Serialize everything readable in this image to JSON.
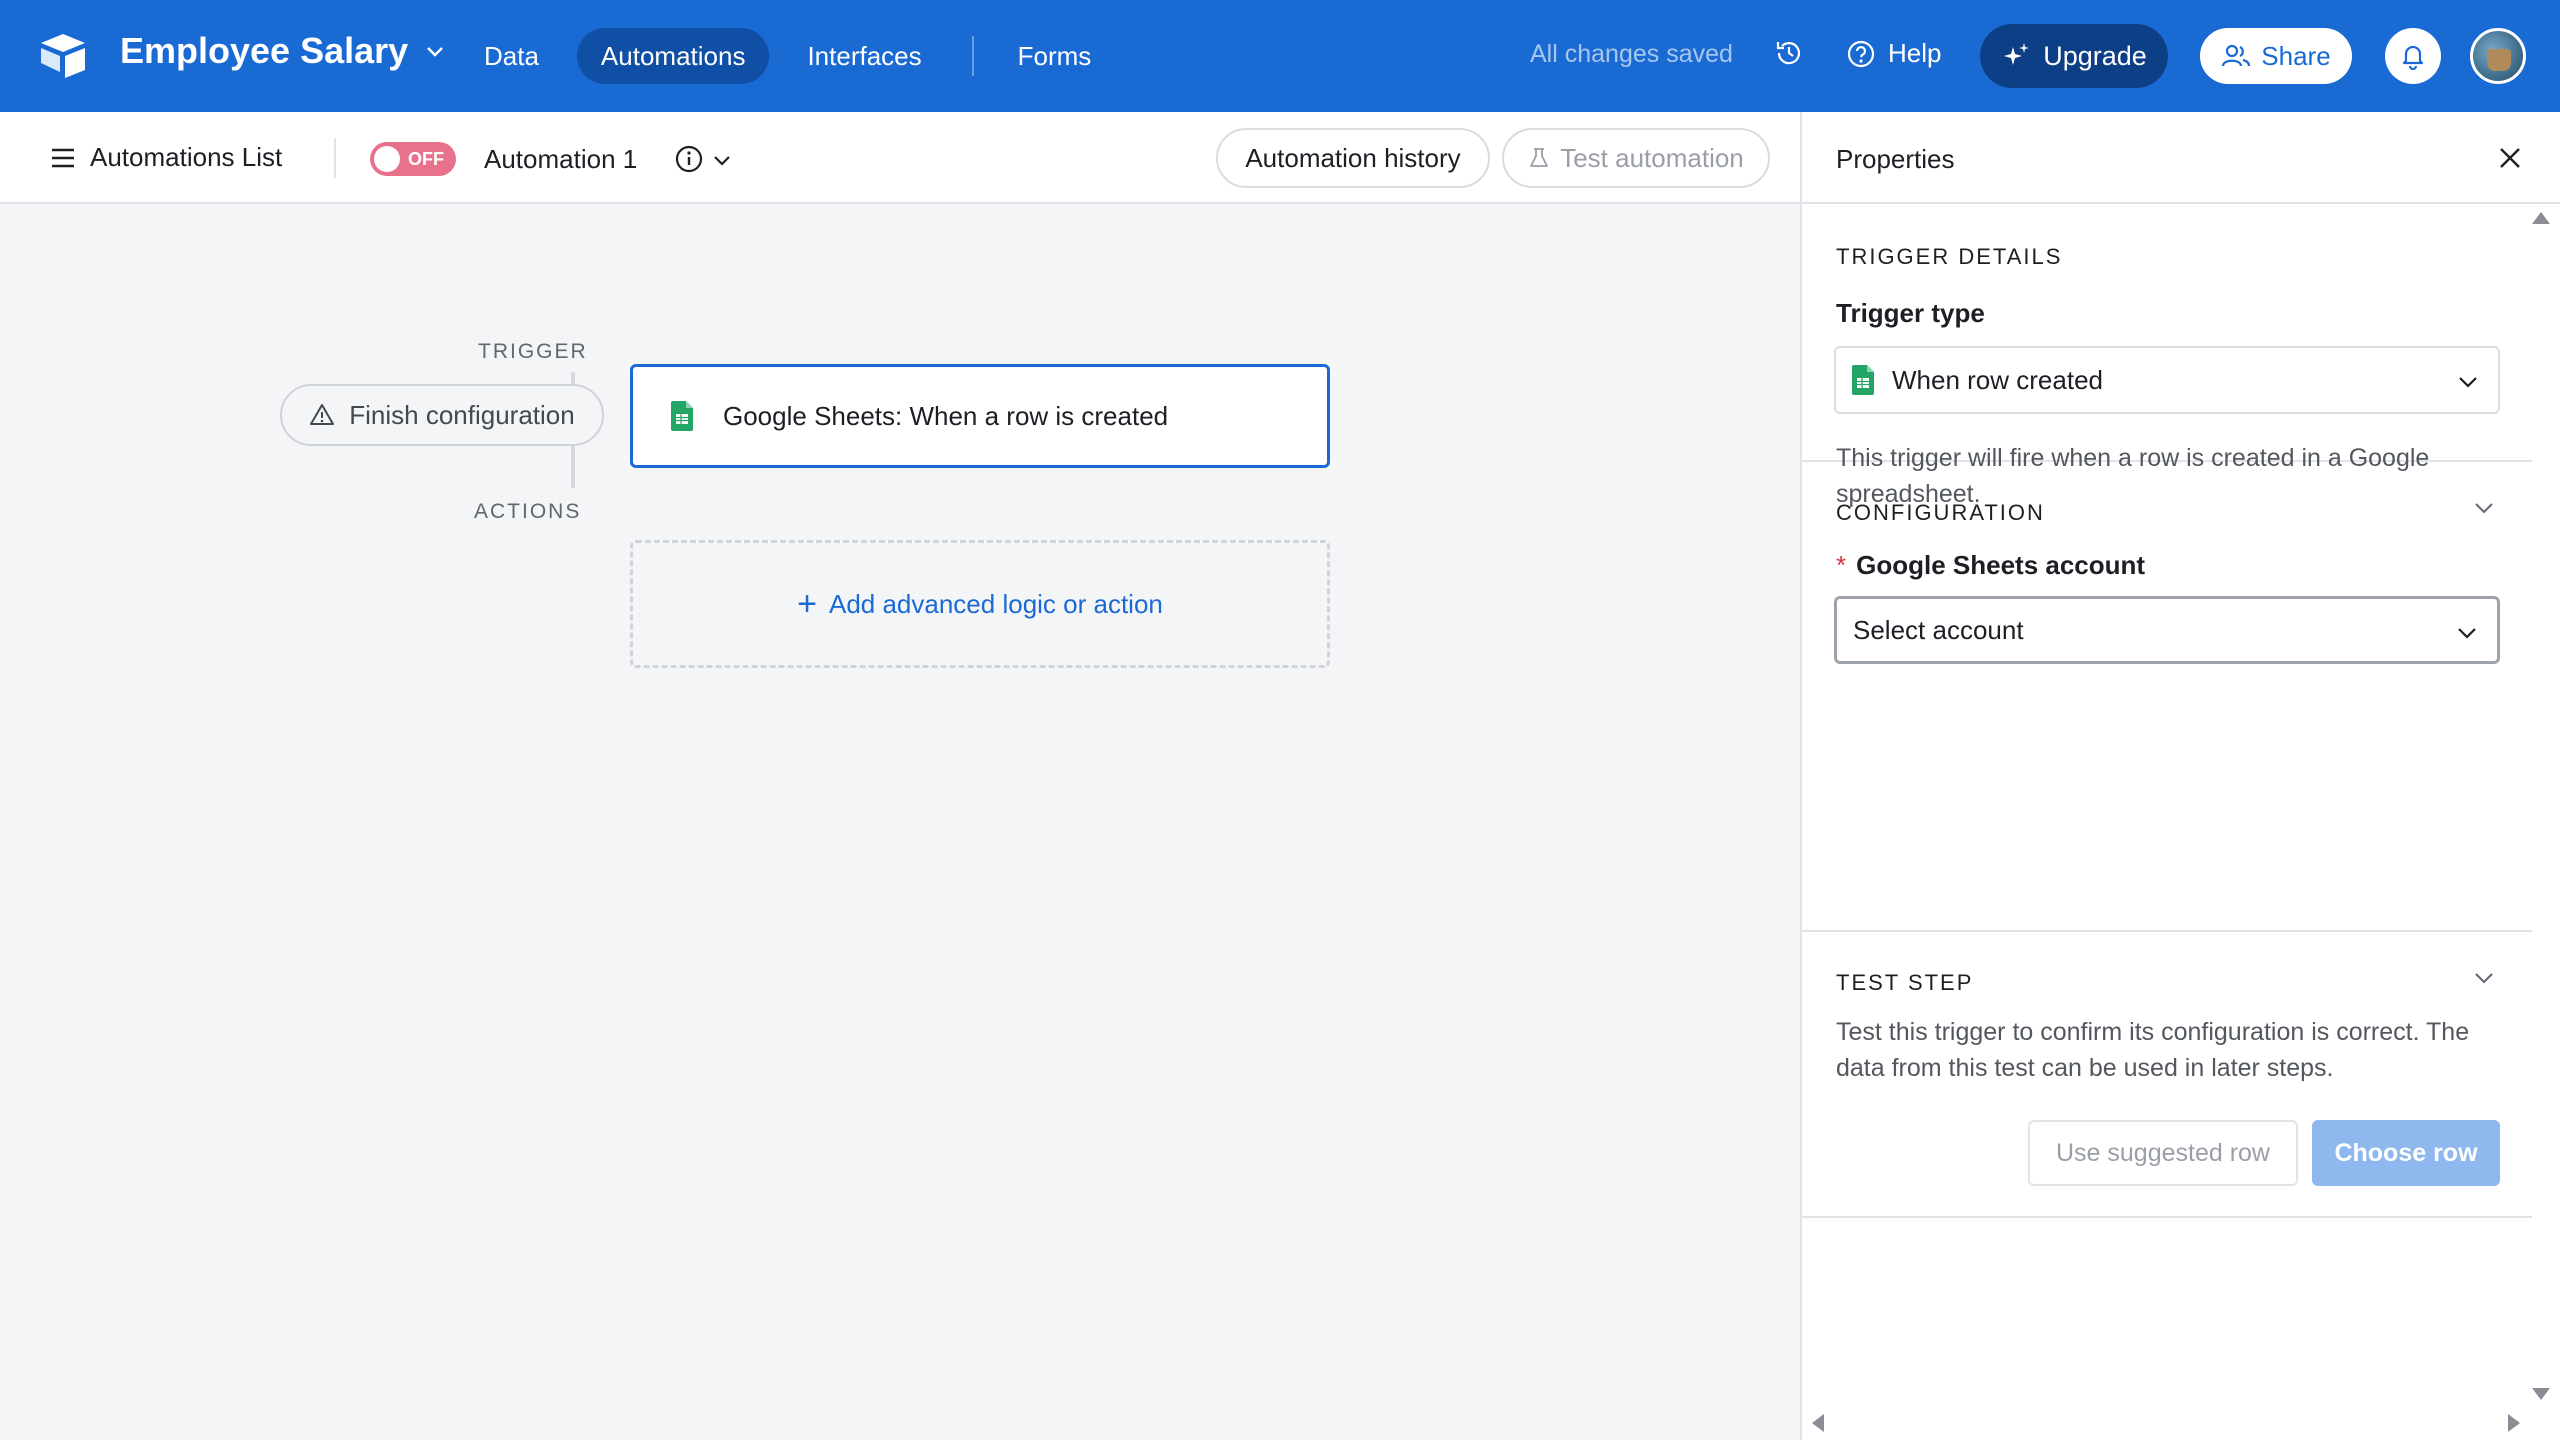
{
  "colors": {
    "brand": "#1a6ad4",
    "toggle_off": "#e8728c",
    "primary_disabled": "#8fb8ee"
  },
  "header": {
    "base_title": "Employee Salary",
    "nav": [
      "Data",
      "Automations",
      "Interfaces",
      "Forms"
    ],
    "active_nav": "Automations",
    "saved_status": "All changes saved",
    "help_label": "Help",
    "upgrade_label": "Upgrade",
    "share_label": "Share"
  },
  "toolbar": {
    "list_label": "Automations List",
    "toggle_label": "OFF",
    "automation_name": "Automation 1",
    "history_label": "Automation history",
    "test_label": "Test automation"
  },
  "canvas": {
    "trigger_label": "TRIGGER",
    "actions_label": "ACTIONS",
    "finish_label": "Finish configuration",
    "trigger_card_label": "Google Sheets: When a row is created",
    "add_action_label": "Add advanced logic or action"
  },
  "panel": {
    "title": "Properties",
    "trigger_details": {
      "title": "TRIGGER DETAILS",
      "type_label": "Trigger type",
      "type_value": "When row created",
      "description": "This trigger will fire when a row is created in a Google spreadsheet."
    },
    "configuration": {
      "title": "CONFIGURATION",
      "required_mark": "*",
      "account_label": "Google Sheets account",
      "account_placeholder": "Select account"
    },
    "test_step": {
      "title": "TEST STEP",
      "description": "Test this trigger to confirm its configuration is correct. The data from this test can be used in later steps.",
      "suggested_label": "Use suggested row",
      "choose_label": "Choose row"
    }
  }
}
